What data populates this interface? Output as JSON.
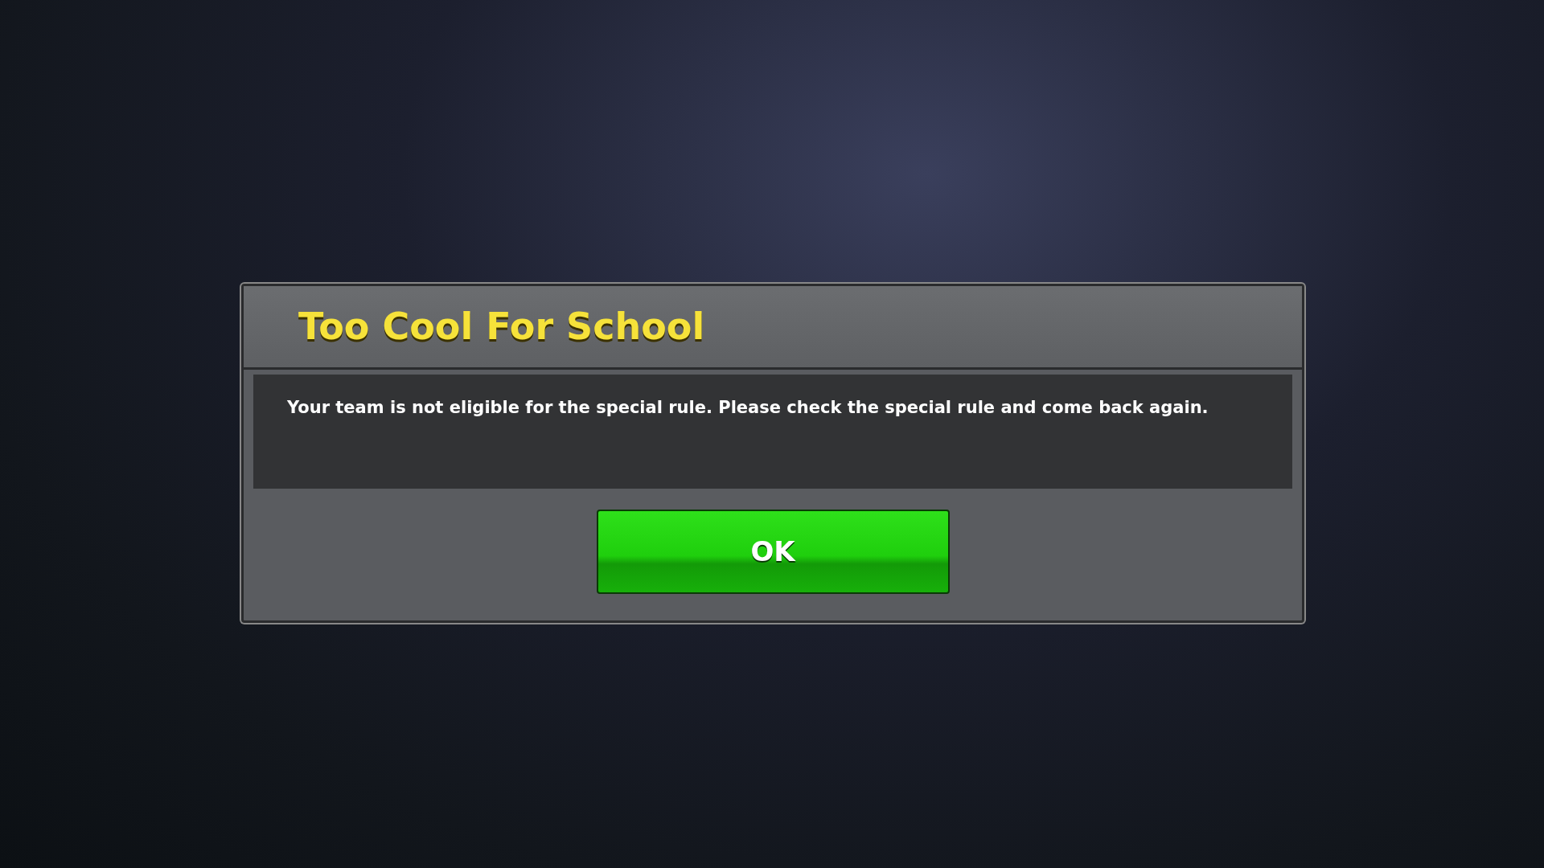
{
  "dialog": {
    "title": "Too Cool For School",
    "message": "Your team is not eligible for the special rule. Please check the special rule and come back again.",
    "buttons": [
      "OK"
    ]
  }
}
